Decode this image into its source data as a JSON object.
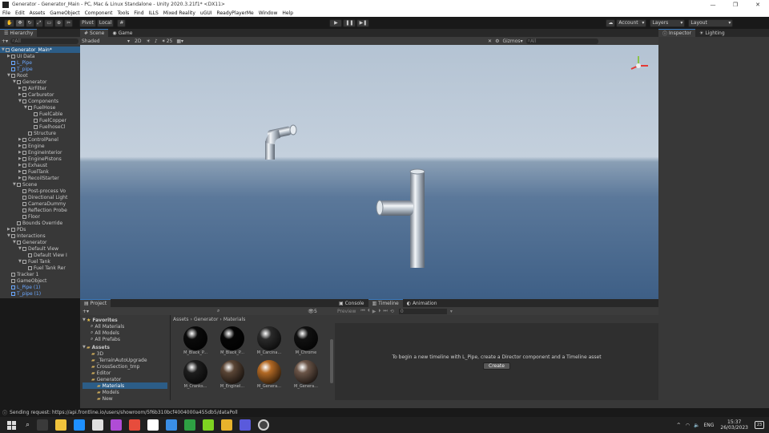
{
  "window": {
    "title": "Generator - Generator_Main - PC, Mac & Linux Standalone - Unity 2020.3.21f1* <DX11>",
    "controls": [
      "—",
      "❐",
      "✕"
    ]
  },
  "menu": [
    "File",
    "Edit",
    "Assets",
    "GameObject",
    "Component",
    "Tools",
    "Find",
    "ILLS",
    "Mixed Reality",
    "uGUI",
    "ReadyPlayerMe",
    "Window",
    "Help"
  ],
  "toolbar": {
    "pivot": "Pivot",
    "local": "Local",
    "account": "Account",
    "layers": "Layers",
    "layout": "Layout",
    "play": "▶",
    "pause": "❚❚",
    "step": "▶❚"
  },
  "hierarchy": {
    "tab": "Hierarchy",
    "search_placeholder": "All",
    "rows": [
      {
        "label": "Generator_Main*",
        "indent": 0,
        "arrow": "▼",
        "style": "sel"
      },
      {
        "label": "UI Data",
        "indent": 1,
        "arrow": "▶",
        "style": ""
      },
      {
        "label": "L_Pipe",
        "indent": 1,
        "arrow": "",
        "style": "blue"
      },
      {
        "label": "T_pipe",
        "indent": 1,
        "arrow": "",
        "style": "blue"
      },
      {
        "label": "Root",
        "indent": 1,
        "arrow": "▼",
        "style": ""
      },
      {
        "label": "Generator",
        "indent": 2,
        "arrow": "▼",
        "style": ""
      },
      {
        "label": "AirFilter",
        "indent": 3,
        "arrow": "▶",
        "style": ""
      },
      {
        "label": "Carburetor",
        "indent": 3,
        "arrow": "▶",
        "style": ""
      },
      {
        "label": "Components",
        "indent": 3,
        "arrow": "▼",
        "style": ""
      },
      {
        "label": "FuelHose",
        "indent": 4,
        "arrow": "▼",
        "style": ""
      },
      {
        "label": "FuelCable",
        "indent": 5,
        "arrow": "",
        "style": ""
      },
      {
        "label": "FuelCopper",
        "indent": 5,
        "arrow": "",
        "style": ""
      },
      {
        "label": "FuelhoseCl",
        "indent": 5,
        "arrow": "",
        "style": ""
      },
      {
        "label": "Structure",
        "indent": 4,
        "arrow": "",
        "style": ""
      },
      {
        "label": "ControlPanel",
        "indent": 3,
        "arrow": "▶",
        "style": ""
      },
      {
        "label": "Engine",
        "indent": 3,
        "arrow": "▶",
        "style": ""
      },
      {
        "label": "EngineInterior",
        "indent": 3,
        "arrow": "▶",
        "style": ""
      },
      {
        "label": "EnginePistons",
        "indent": 3,
        "arrow": "▶",
        "style": ""
      },
      {
        "label": "Exhaust",
        "indent": 3,
        "arrow": "▶",
        "style": ""
      },
      {
        "label": "FuelTank",
        "indent": 3,
        "arrow": "▶",
        "style": ""
      },
      {
        "label": "RecoilStarter",
        "indent": 3,
        "arrow": "▶",
        "style": ""
      },
      {
        "label": "Scene",
        "indent": 2,
        "arrow": "▼",
        "style": ""
      },
      {
        "label": "Post-process Vo",
        "indent": 3,
        "arrow": "",
        "style": ""
      },
      {
        "label": "Directional Light",
        "indent": 3,
        "arrow": "",
        "style": ""
      },
      {
        "label": "CameraDummy",
        "indent": 3,
        "arrow": "",
        "style": ""
      },
      {
        "label": "Reflection Probe",
        "indent": 3,
        "arrow": "",
        "style": ""
      },
      {
        "label": "Floor",
        "indent": 3,
        "arrow": "",
        "style": ""
      },
      {
        "label": "Bounds Override",
        "indent": 2,
        "arrow": "",
        "style": ""
      },
      {
        "label": "PDs",
        "indent": 1,
        "arrow": "▶",
        "style": ""
      },
      {
        "label": "Interactions",
        "indent": 1,
        "arrow": "▼",
        "style": ""
      },
      {
        "label": "Generator",
        "indent": 2,
        "arrow": "▼",
        "style": ""
      },
      {
        "label": "Default View",
        "indent": 3,
        "arrow": "▼",
        "style": ""
      },
      {
        "label": "Default View I",
        "indent": 4,
        "arrow": "",
        "style": ""
      },
      {
        "label": "Fuel Tank",
        "indent": 3,
        "arrow": "▼",
        "style": ""
      },
      {
        "label": "Fuel Tank Rer",
        "indent": 4,
        "arrow": "",
        "style": ""
      },
      {
        "label": "Tracker 1",
        "indent": 1,
        "arrow": "",
        "style": ""
      },
      {
        "label": "GameObject",
        "indent": 1,
        "arrow": "",
        "style": ""
      },
      {
        "label": "L_Pipe (1)",
        "indent": 1,
        "arrow": "",
        "style": "blue"
      },
      {
        "label": "T_pipe (1)",
        "indent": 1,
        "arrow": "",
        "style": "blue"
      }
    ]
  },
  "scene": {
    "tabs": [
      "Scene",
      "Game"
    ],
    "shading": "Shaded",
    "mode_2d": "2D",
    "gizmos": "Gizmos",
    "search_placeholder": "All",
    "fx_count": "25"
  },
  "inspector": {
    "tabs": [
      "Inspector",
      "Lighting"
    ]
  },
  "project": {
    "tab": "Project",
    "breadcrumb": [
      "Assets",
      "Generator",
      "Materials"
    ],
    "count": "5",
    "favorites_title": "Favorites",
    "favorites": [
      "All Materials",
      "All Models",
      "All Prefabs"
    ],
    "assets_title": "Assets",
    "folders": [
      {
        "label": "3D",
        "indent": 1
      },
      {
        "label": "_TerrainAutoUpgrade",
        "indent": 1
      },
      {
        "label": "CrossSection_tmp",
        "indent": 1
      },
      {
        "label": "Editor",
        "indent": 1
      },
      {
        "label": "Generator",
        "indent": 1
      },
      {
        "label": "Materials",
        "indent": 2
      },
      {
        "label": "Models",
        "indent": 2
      },
      {
        "label": "New",
        "indent": 2
      }
    ],
    "materials": [
      {
        "label": "M_Black_P...",
        "color": "#0a0a0a"
      },
      {
        "label": "M_Black_P...",
        "color": "#050505"
      },
      {
        "label": "M_Carcina...",
        "color": "#2a2a2a"
      },
      {
        "label": "M_Chrome",
        "color": "#111111"
      },
      {
        "label": "M_Cranks...",
        "color": "#1e1e1e"
      },
      {
        "label": "M_EngineI...",
        "color": "#5a4535"
      },
      {
        "label": "M_Genera...",
        "color": "#b36a25"
      },
      {
        "label": "M_Genera...",
        "color": "#6b5548"
      }
    ]
  },
  "timeline": {
    "tabs": [
      "Console",
      "Timeline",
      "Animation"
    ],
    "preview": "Preview",
    "frame": "0",
    "message": "To begin a new timeline with L_Pipe, create a Director component and a Timeline asset",
    "create": "Create"
  },
  "status": {
    "text": "Sending request: https://api.frontline.io/users/showroom/5f6b310bcf4004000a455db5/dataPoll"
  },
  "taskbar": {
    "lang": "ENG",
    "time": "15:37",
    "date": "26/03/2023",
    "notif": "23",
    "app_colors": [
      "#3a3a3a",
      "#f0c33c",
      "#1e90ff",
      "#e0e0e0",
      "#b04cd6",
      "#e74c3c",
      "#ffffff",
      "#3a8ee6",
      "#2ea043",
      "#7ed321",
      "#e8b32c",
      "#5a5adc",
      "#d0d0d0"
    ]
  }
}
